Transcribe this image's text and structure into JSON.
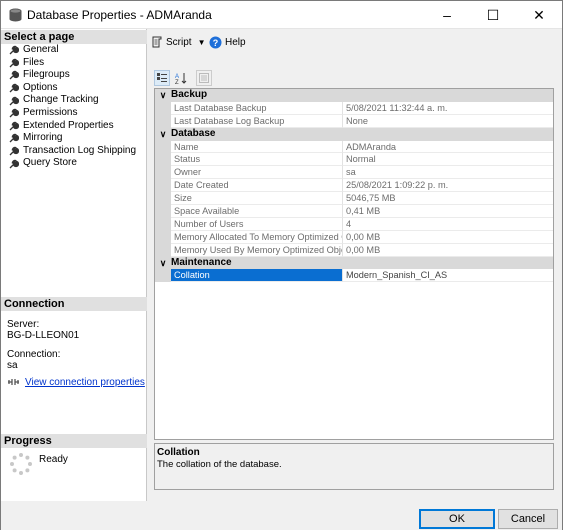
{
  "window": {
    "title": "Database Properties - ADMAranda",
    "minimize_glyph": "–",
    "maximize_glyph": "☐",
    "close_glyph": "✕"
  },
  "left": {
    "select_page_header": "Select a page",
    "pages": [
      {
        "label": "General",
        "icon": "wrench-icon"
      },
      {
        "label": "Files",
        "icon": "wrench-icon"
      },
      {
        "label": "Filegroups",
        "icon": "wrench-icon"
      },
      {
        "label": "Options",
        "icon": "wrench-icon"
      },
      {
        "label": "Change Tracking",
        "icon": "wrench-icon"
      },
      {
        "label": "Permissions",
        "icon": "wrench-icon"
      },
      {
        "label": "Extended Properties",
        "icon": "wrench-icon"
      },
      {
        "label": "Mirroring",
        "icon": "wrench-icon"
      },
      {
        "label": "Transaction Log Shipping",
        "icon": "wrench-icon"
      },
      {
        "label": "Query Store",
        "icon": "wrench-icon"
      }
    ],
    "connection_header": "Connection",
    "server_label": "Server:",
    "server_value": "BG-D-LLEON01",
    "connection_label": "Connection:",
    "connection_value": "sa",
    "view_connection_link": "View connection properties",
    "progress_header": "Progress",
    "progress_status": "Ready"
  },
  "toolbar": {
    "script_label": "Script",
    "help_label": "Help"
  },
  "grid": {
    "categories": [
      {
        "name": "Backup",
        "rows": [
          {
            "name": "Last Database Backup",
            "value": "5/08/2021 11:32:44 a. m."
          },
          {
            "name": "Last Database Log Backup",
            "value": "None"
          }
        ]
      },
      {
        "name": "Database",
        "rows": [
          {
            "name": "Name",
            "value": "ADMAranda"
          },
          {
            "name": "Status",
            "value": "Normal"
          },
          {
            "name": "Owner",
            "value": "sa"
          },
          {
            "name": "Date Created",
            "value": "25/08/2021 1:09:22 p. m."
          },
          {
            "name": "Size",
            "value": "5046,75 MB"
          },
          {
            "name": "Space Available",
            "value": "0,41 MB"
          },
          {
            "name": "Number of Users",
            "value": "4"
          },
          {
            "name": "Memory Allocated To Memory Optimized Obje",
            "value": "0,00 MB"
          },
          {
            "name": "Memory Used By Memory Optimized Objects",
            "value": "0,00 MB"
          }
        ]
      },
      {
        "name": "Maintenance",
        "rows": [
          {
            "name": "Collation",
            "value": "Modern_Spanish_CI_AS",
            "selected": true
          }
        ]
      }
    ]
  },
  "description": {
    "title": "Collation",
    "text": "The collation of the database."
  },
  "buttons": {
    "ok": "OK",
    "cancel": "Cancel"
  }
}
